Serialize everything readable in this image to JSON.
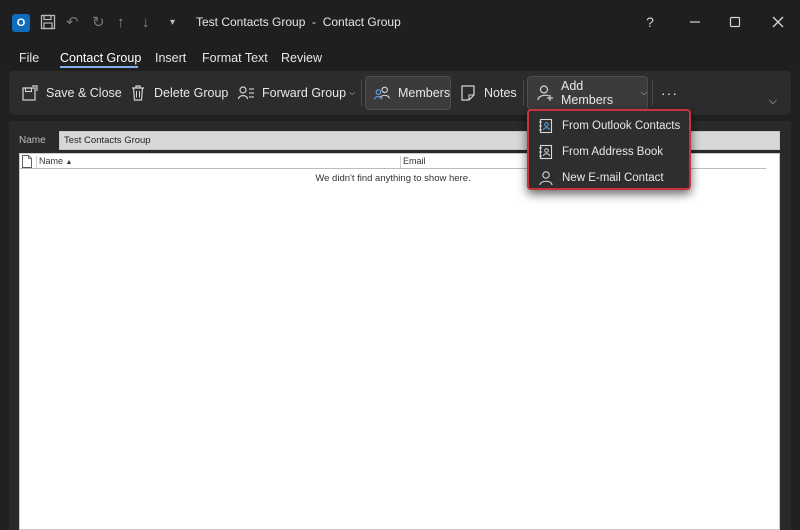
{
  "titlebar": {
    "app_icon": "outlook-icon",
    "title": "Test Contacts Group  -  Contact Group",
    "help": "?"
  },
  "menu": {
    "items": [
      "File",
      "Contact Group",
      "Insert",
      "Format Text",
      "Review"
    ],
    "active": "Contact Group"
  },
  "ribbon": {
    "save_close": "Save & Close",
    "delete_group": "Delete Group",
    "forward_group": "Forward Group",
    "members": "Members",
    "notes": "Notes",
    "add_members": "Add Members",
    "more": "···"
  },
  "form": {
    "name_label": "Name",
    "name_value": "Test Contacts Group"
  },
  "list": {
    "columns": [
      "Name",
      "Email"
    ],
    "empty_message": "We didn't find anything to show here."
  },
  "add_members_menu": {
    "items": [
      "From Outlook Contacts",
      "From Address Book",
      "New E-mail Contact"
    ]
  },
  "colors": {
    "accent": "#7fb0e8",
    "highlight_border": "#c8323c",
    "background": "#202020"
  }
}
